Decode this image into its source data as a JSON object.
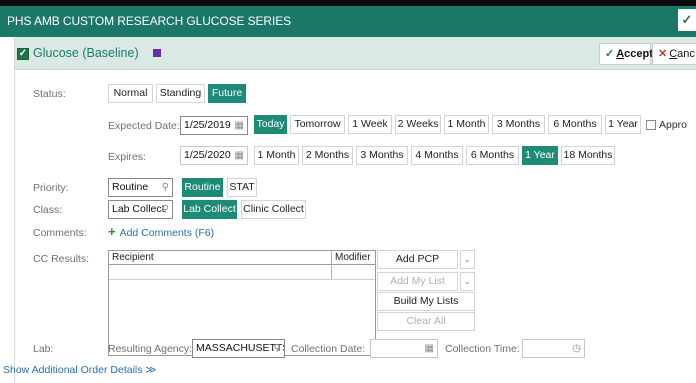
{
  "window": {
    "title": "PHS AMB CUSTOM RESEARCH GLUCOSE SERIES"
  },
  "order": {
    "name": "Glucose (Baseline)",
    "accept_label": "ccept",
    "accept_key": "A",
    "cancel_label": "anc",
    "cancel_key": "C"
  },
  "status": {
    "label": "Status:",
    "options": [
      "Normal",
      "Standing",
      "Future"
    ],
    "selected": "Future"
  },
  "expected_date": {
    "label": "Expected Date:",
    "value": "1/25/2019",
    "quick": [
      "Today",
      "Tomorrow",
      "1 Week",
      "2 Weeks",
      "1 Month",
      "3 Months",
      "6 Months",
      "1 Year"
    ],
    "selected": "Today",
    "approx_label": "Appro"
  },
  "expires": {
    "label": "Expires:",
    "value": "1/25/2020",
    "quick": [
      "1 Month",
      "2 Months",
      "3 Months",
      "4 Months",
      "6 Months",
      "1 Year",
      "18 Months"
    ],
    "selected": "1 Year"
  },
  "priority": {
    "label": "Priority:",
    "value": "Routine",
    "options": [
      "Routine",
      "STAT"
    ],
    "selected": "Routine"
  },
  "class": {
    "label": "Class:",
    "value": "Lab Collect",
    "options": [
      "Lab Collect",
      "Clinic Collect"
    ],
    "selected": "Lab Collect"
  },
  "comments": {
    "label": "Comments:",
    "link": "Add Comments (F6)"
  },
  "cc_results": {
    "label": "CC Results:",
    "columns": [
      "Recipient",
      "Modifier"
    ],
    "buttons": {
      "add_pcp": "Add PCP",
      "add_my_list": "Add My List",
      "build_my_lists": "Build My Lists",
      "clear_all": "Clear All"
    }
  },
  "lab": {
    "label": "Lab:",
    "resulting_agency_label": "Resulting Agency:",
    "resulting_agency_value": "MASSACHUSETTS",
    "collection_date_label": "Collection Date:",
    "collection_time_label": "Collection Time:"
  },
  "footer": {
    "link": "Show Additional Order Details"
  },
  "colors": {
    "header_bg": "#1b7768",
    "selected_bg": "#1e8a78",
    "panel_head_bg": "#dbe9e4"
  }
}
